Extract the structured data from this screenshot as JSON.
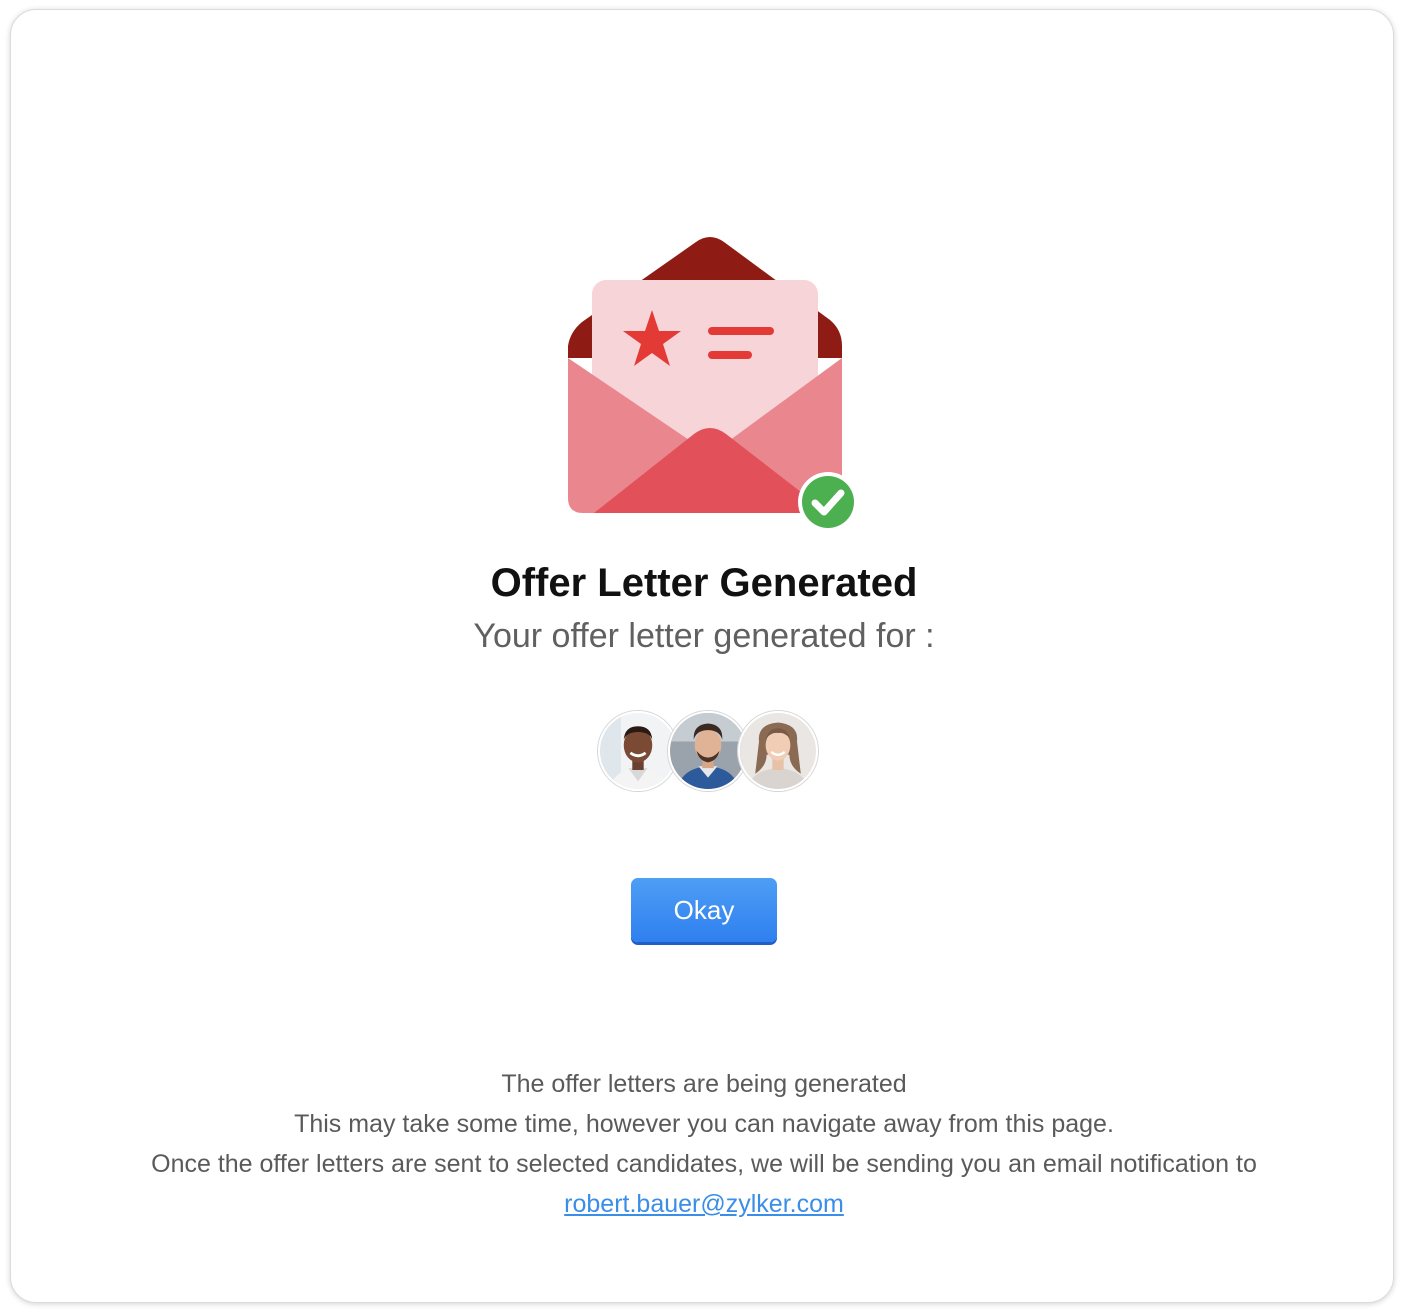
{
  "dialog": {
    "title": "Offer Letter Generated",
    "subtitle": "Your offer letter generated for :",
    "illustration_icon": "envelope-offer-letter-icon",
    "status_icon": "check-circle-icon",
    "candidates": [
      {
        "avatar": "candidate-avatar-1"
      },
      {
        "avatar": "candidate-avatar-2"
      },
      {
        "avatar": "candidate-avatar-3"
      }
    ],
    "okay_label": "Okay",
    "notes": {
      "line1": "The offer letters are being generated",
      "line2": "This may take some time, however you can navigate away from this page.",
      "line3": "Once the offer letters are sent to selected candidates, we will be sending you an email notification to",
      "email": "robert.bauer@zylker.com"
    }
  },
  "colors": {
    "primary_button": "#3b8ef2",
    "link": "#3b8ee8",
    "success": "#4caf50",
    "envelope_dark": "#8e1c14",
    "envelope_body": "#e9868e",
    "envelope_front": "#e2505a",
    "letter": "#f7d4d8",
    "star": "#e43a36"
  }
}
